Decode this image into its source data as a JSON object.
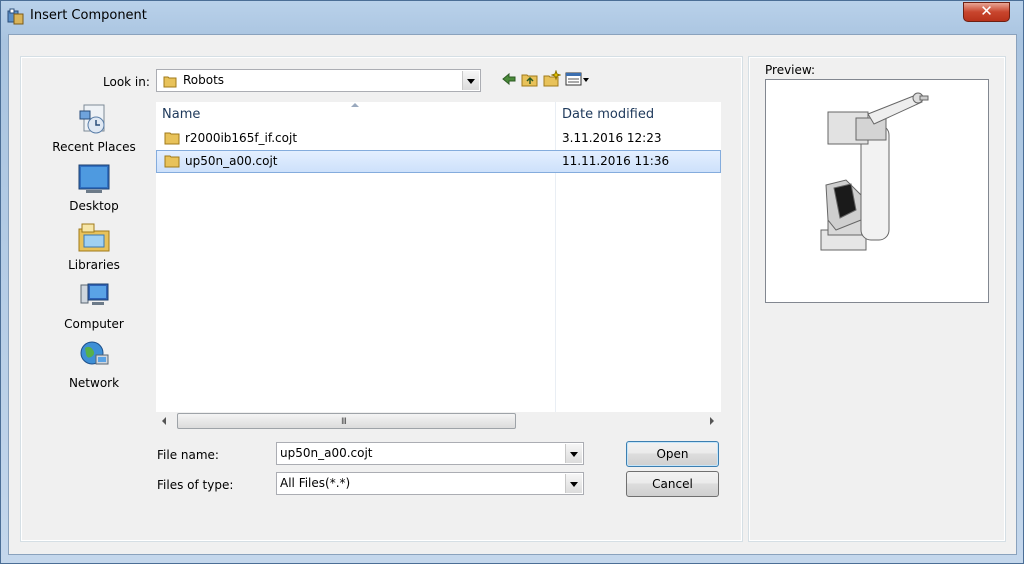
{
  "window": {
    "title": "Insert Component",
    "close_glyph": "✕"
  },
  "look_in": {
    "label": "Look in:",
    "value": "Robots"
  },
  "places": [
    {
      "label": "Recent Places",
      "icon": "recent-places-icon"
    },
    {
      "label": "Desktop",
      "icon": "desktop-icon"
    },
    {
      "label": "Libraries",
      "icon": "libraries-icon"
    },
    {
      "label": "Computer",
      "icon": "computer-icon"
    },
    {
      "label": "Network",
      "icon": "network-icon"
    }
  ],
  "file_list": {
    "columns": [
      "Name",
      "Date modified"
    ],
    "rows": [
      {
        "name": "r2000ib165f_if.cojt",
        "date": "3.11.2016 12:23",
        "selected": false
      },
      {
        "name": "up50n_a00.cojt",
        "date": "11.11.2016 11:36",
        "selected": true
      }
    ],
    "scroll_grip": "III"
  },
  "file_name": {
    "label": "File name:",
    "value": "up50n_a00.cojt"
  },
  "file_type": {
    "label": "Files of type:",
    "value": "All Files(*.*)"
  },
  "buttons": {
    "open": "Open",
    "cancel": "Cancel"
  },
  "preview": {
    "label": "Preview:"
  },
  "colors": {
    "folder": "#e8c25a",
    "selection": "#cde1fb",
    "title_gradient": "#b9d1ea",
    "close": "#c8452d"
  }
}
